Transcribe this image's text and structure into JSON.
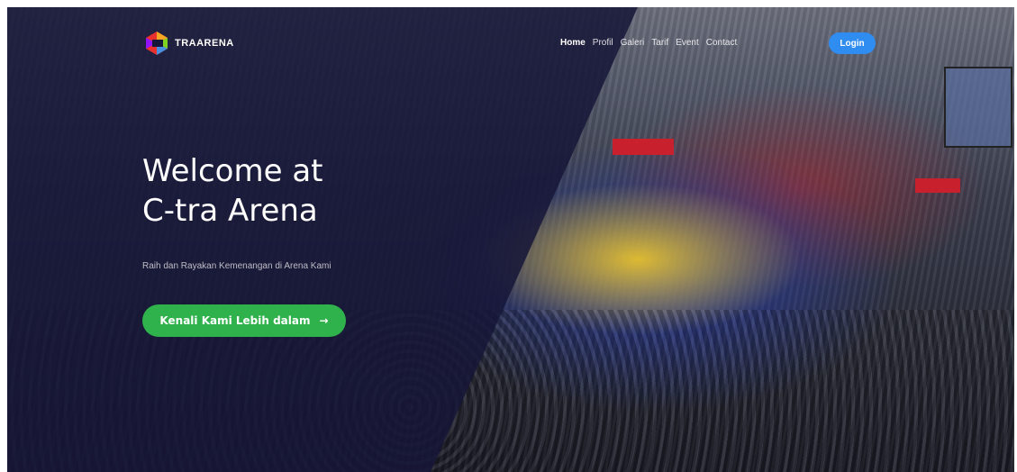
{
  "brand": {
    "logo_text": "TRAARENA"
  },
  "nav": {
    "items": [
      "Home",
      "Profil",
      "Galeri",
      "Tarif",
      "Event",
      "Contact"
    ],
    "login_label": "Login"
  },
  "hero": {
    "title_line1": "Welcome at",
    "title_line2": "C-tra Arena",
    "subtitle": "Raih dan Rayakan Kemenangan di Arena Kami",
    "cta_label": "Kenali Kami Lebih dalam",
    "cta_icon": "arrow-right-icon"
  },
  "colors": {
    "overlay": "#16163a",
    "cta": "#2fb24b",
    "login": "#2f8cf0"
  }
}
